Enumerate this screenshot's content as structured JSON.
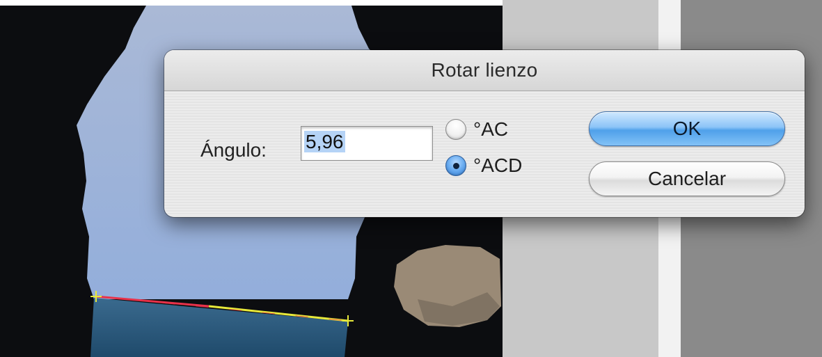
{
  "dialog": {
    "title": "Rotar lienzo",
    "angle_label": "Ángulo:",
    "angle_value": "5,96",
    "options": [
      {
        "label": "°AC",
        "selected": false
      },
      {
        "label": "°ACD",
        "selected": true
      }
    ],
    "ok_label": "OK",
    "cancel_label": "Cancelar"
  },
  "colors": {
    "accent": "#4fa0ea",
    "measure_line_red": "#e8324a",
    "measure_line_yellow": "#e7e93a",
    "sky": "#9eb6d8",
    "sea": "#2b5778"
  }
}
